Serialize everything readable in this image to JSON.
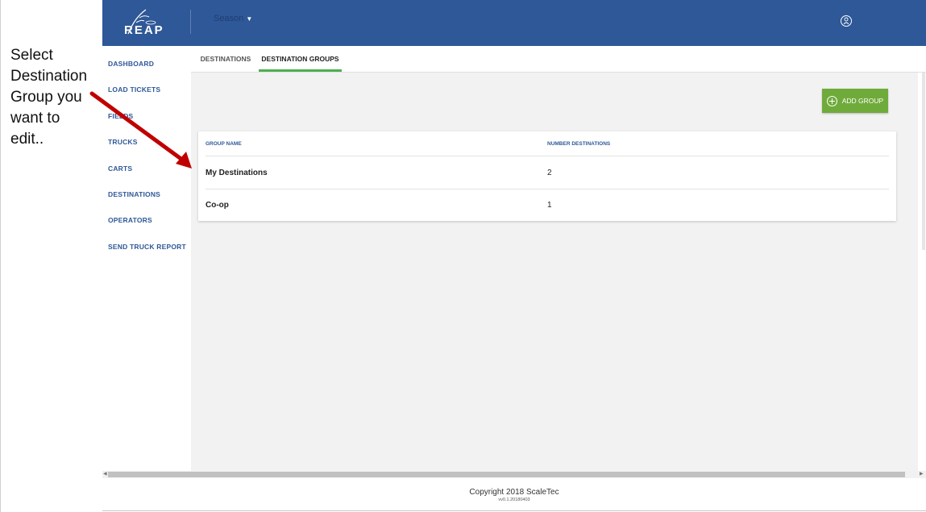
{
  "annotation": {
    "lines": [
      "Select",
      "Destination",
      "Group you",
      "want to",
      "edit.."
    ],
    "arrow_color": "#c00000"
  },
  "header": {
    "logo_text": "REAP",
    "season_label": "Season",
    "brand_color": "#2e5897"
  },
  "sidebar": {
    "items": [
      {
        "label": "DASHBOARD"
      },
      {
        "label": "LOAD TICKETS"
      },
      {
        "label": "FIELDS"
      },
      {
        "label": "TRUCKS"
      },
      {
        "label": "CARTS"
      },
      {
        "label": "DESTINATIONS"
      },
      {
        "label": "OPERATORS"
      },
      {
        "label": "SEND TRUCK REPORT"
      }
    ]
  },
  "tabs": [
    {
      "label": "DESTINATIONS",
      "active": false
    },
    {
      "label": "DESTINATION GROUPS",
      "active": true
    }
  ],
  "actions": {
    "add_group_label": "ADD GROUP",
    "add_group_color": "#6fab3b"
  },
  "table": {
    "headers": [
      "GROUP NAME",
      "NUMBER DESTINATIONS"
    ],
    "rows": [
      {
        "name": "My Destinations",
        "count": "2"
      },
      {
        "name": "Co-op",
        "count": "1"
      }
    ]
  },
  "footer": {
    "copyright": "Copyright 2018 ScaleTec",
    "version": "vv0.1.20180403"
  }
}
